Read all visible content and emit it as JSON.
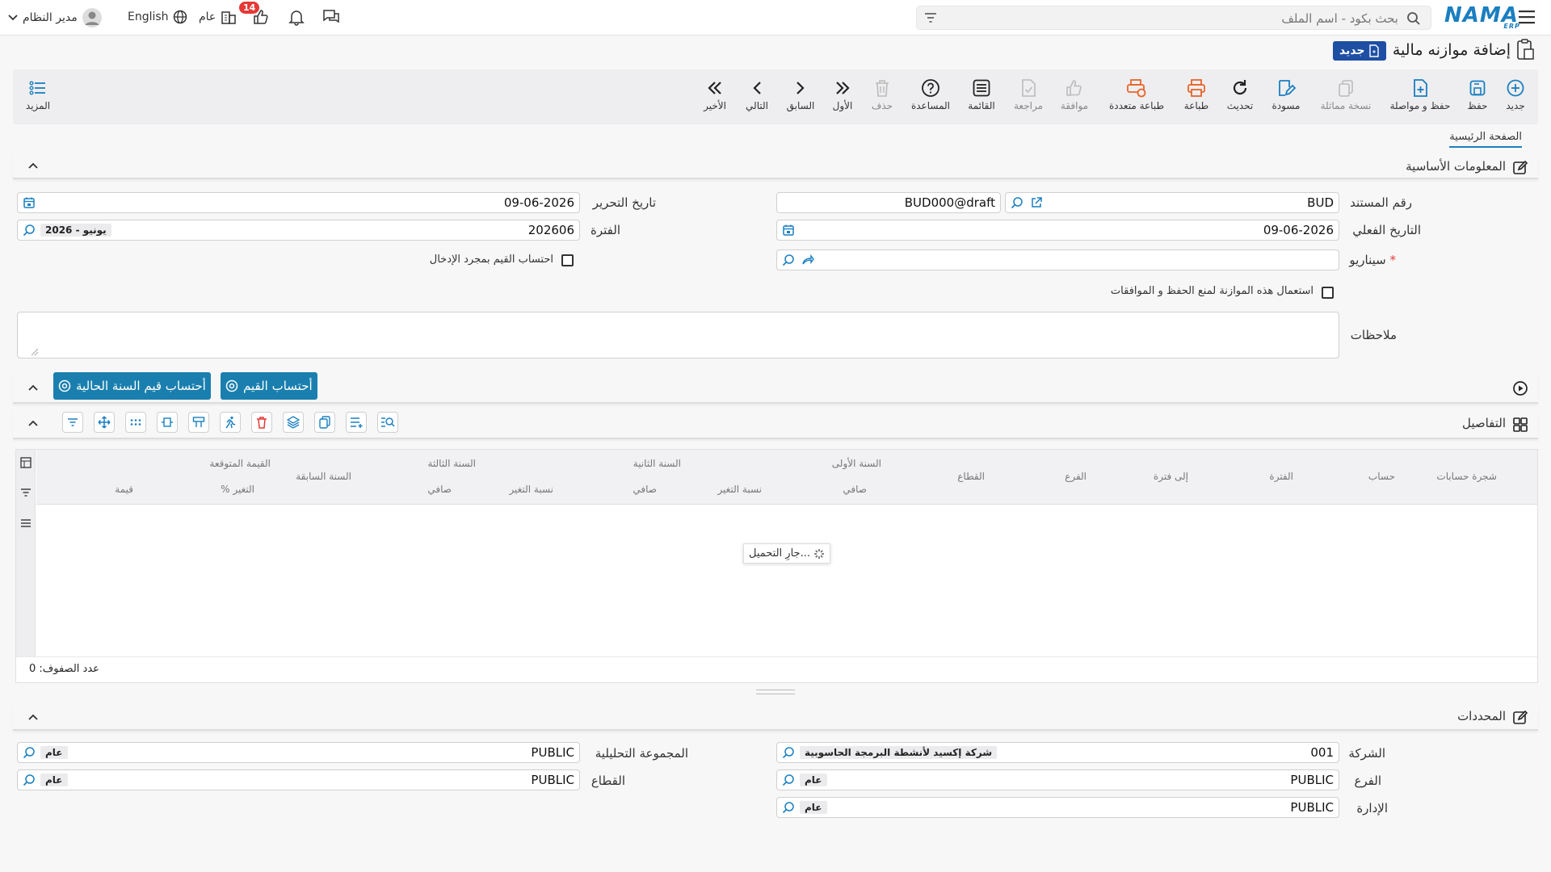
{
  "topbar": {
    "search_placeholder": "بحث بكود - اسم الملف",
    "logo_text": "NAMA",
    "logo_sub": "ERP",
    "user_name": "مدير النظام",
    "language": "English",
    "scope_label": "عام",
    "approvals_count": "14"
  },
  "page": {
    "title": "إضافة موازنه مالية",
    "status_tag": "جديد"
  },
  "toolbar": {
    "new": "جديد",
    "save": "حفظ",
    "save_continue": "حفظ و مواصلة",
    "duplicate": "نسخة مماثلة",
    "draft": "مسودة",
    "refresh": "تحديث",
    "print": "طباعة",
    "multi_print": "طباعة متعددة",
    "approve": "موافقة",
    "review": "مراجعة",
    "list": "القائمة",
    "help": "المساعدة",
    "delete": "حذف",
    "first": "الأول",
    "previous": "السابق",
    "next": "التالي",
    "last": "الأخير",
    "more": "المزيد"
  },
  "tabs": {
    "main": "الصفحة الرئيسية"
  },
  "basic": {
    "section_title": "المعلومات الأساسية",
    "doc_no_label": "رقم المستند",
    "doc_no_prefix": "BUD",
    "doc_no_value": "BUD000@draft",
    "value_date_label": "التاريخ الفعلي",
    "value_date": "09-06-2026",
    "scenario_label": "سيناريو",
    "lock_label": "استعمال هذه الموازنة لمنع الحفظ و الموافقات",
    "edit_date_label": "تاريخ التحرير",
    "edit_date": "09-06-2026",
    "period_label": "الفترة",
    "period_value": "202606",
    "period_chip": "2026 - يونيو",
    "calc_on_entry_label": "احتساب القيم بمجرد الإدخال",
    "notes_label": "ملاحظات"
  },
  "actions": {
    "calc_values": "أحتساب القيم",
    "calc_current_year": "أحتساب قيم السنة الحالية"
  },
  "details": {
    "section_title": "التفاصيل",
    "columns": {
      "tree": "شجرة حسابات",
      "account": "حساب",
      "period": "الفترة",
      "to_period": "إلى فترة",
      "branch": "الفرع",
      "sector": "القطاع",
      "year1": "السنة الأولى",
      "year2": "السنة الثانية",
      "year3": "السنة الثالثة",
      "expected": "القيمة المتوقعة",
      "net": "صافي",
      "change_ratio": "نسبة التغير",
      "prev_year": "السنة السابقة",
      "pct_change": "% التغير",
      "value": "قيمة"
    },
    "loading": "جارِ التحميل...",
    "row_count": "عدد الصفوف: 0"
  },
  "dimensions": {
    "section_title": "المحددات",
    "company_label": "الشركة",
    "company_code": "001",
    "company_name": "شركة إكسيد لأنشطة البرمجة الحاسوبية",
    "branch_label": "الفرع",
    "branch_code": "PUBLIC",
    "branch_name": "عام",
    "dept_label": "الإدارة",
    "dept_code": "PUBLIC",
    "dept_name": "عام",
    "analysis_label": "المجموعة التحليلية",
    "analysis_code": "PUBLIC",
    "analysis_name": "عام",
    "sector_label": "القطاع",
    "sector_code": "PUBLIC",
    "sector_name": "عام"
  },
  "colors": {
    "accent": "#1a7fc0",
    "orange": "#e8642a",
    "tag": "#1e4fa3",
    "button": "#1a7fae"
  }
}
